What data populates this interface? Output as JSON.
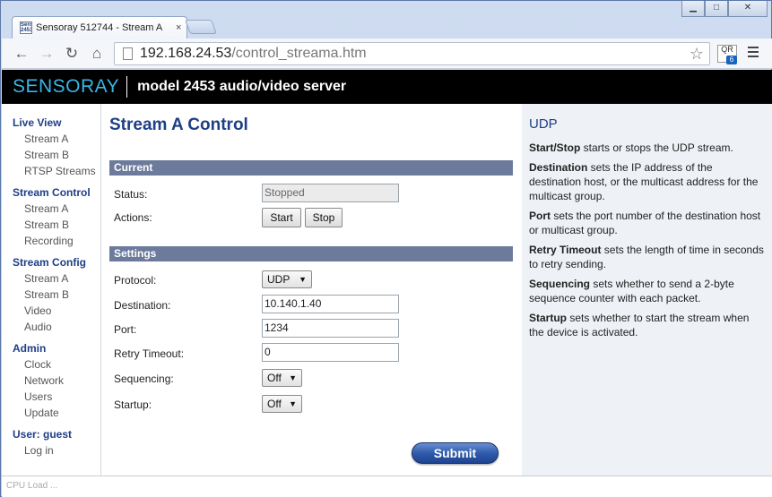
{
  "browser": {
    "tab_title": "Sensoray 512744 - Stream A",
    "tab_close": "×",
    "favicon_text": "Sensoray 2453",
    "window_buttons": {
      "minimize": "▁",
      "maximize": "□",
      "close": "✕"
    },
    "nav": {
      "back": "←",
      "forward": "→",
      "reload": "↻",
      "home": "⌂"
    },
    "url_host": "192.168.24.53",
    "url_path": "/control_streama.htm",
    "star": "☆",
    "extension_badge": "6",
    "extension_text": "QR"
  },
  "banner": {
    "brand": "SENSORAY",
    "model": "model 2453 audio/video server"
  },
  "sidebar": {
    "groups": [
      {
        "head": "Live View",
        "items": [
          "Stream A",
          "Stream B",
          "RTSP Streams"
        ]
      },
      {
        "head": "Stream Control",
        "items": [
          "Stream A",
          "Stream B",
          "Recording"
        ]
      },
      {
        "head": "Stream Config",
        "items": [
          "Stream A",
          "Stream B",
          "Video",
          "Audio"
        ]
      },
      {
        "head": "Admin",
        "items": [
          "Clock",
          "Network",
          "Users",
          "Update"
        ]
      },
      {
        "head": "User: guest",
        "items": [
          "Log in"
        ]
      }
    ]
  },
  "main": {
    "title": "Stream A Control",
    "current": {
      "header": "Current",
      "status_label": "Status:",
      "status_value": "Stopped",
      "actions_label": "Actions:",
      "start": "Start",
      "stop": "Stop"
    },
    "settings": {
      "header": "Settings",
      "protocol_label": "Protocol:",
      "protocol_value": "UDP",
      "destination_label": "Destination:",
      "destination_value": "10.140.1.40",
      "port_label": "Port:",
      "port_value": "1234",
      "retry_label": "Retry Timeout:",
      "retry_value": "0",
      "sequencing_label": "Sequencing:",
      "sequencing_value": "Off",
      "startup_label": "Startup:",
      "startup_value": "Off"
    },
    "submit": "Submit"
  },
  "help": {
    "title": "UDP",
    "items": [
      {
        "term": "Start/Stop",
        "text": " starts or stops the UDP stream."
      },
      {
        "term": "Destination",
        "text": " sets the IP address of the destination host, or the multicast address for the multicast group."
      },
      {
        "term": "Port",
        "text": " sets the port number of the destination host or multicast group."
      },
      {
        "term": "Retry Timeout",
        "text": " sets the length of time in seconds to retry sending."
      },
      {
        "term": "Sequencing",
        "text": " sets whether to send a 2-byte sequence counter with each packet."
      },
      {
        "term": "Startup",
        "text": " sets whether to start the stream when the device is activated."
      }
    ]
  },
  "statusbar": {
    "text": "CPU Load ..."
  },
  "colors": {
    "brand": "#38b6e6",
    "heading": "#1e3f86",
    "section_bar": "#6c7b9c",
    "submit": "#2f5cac"
  }
}
